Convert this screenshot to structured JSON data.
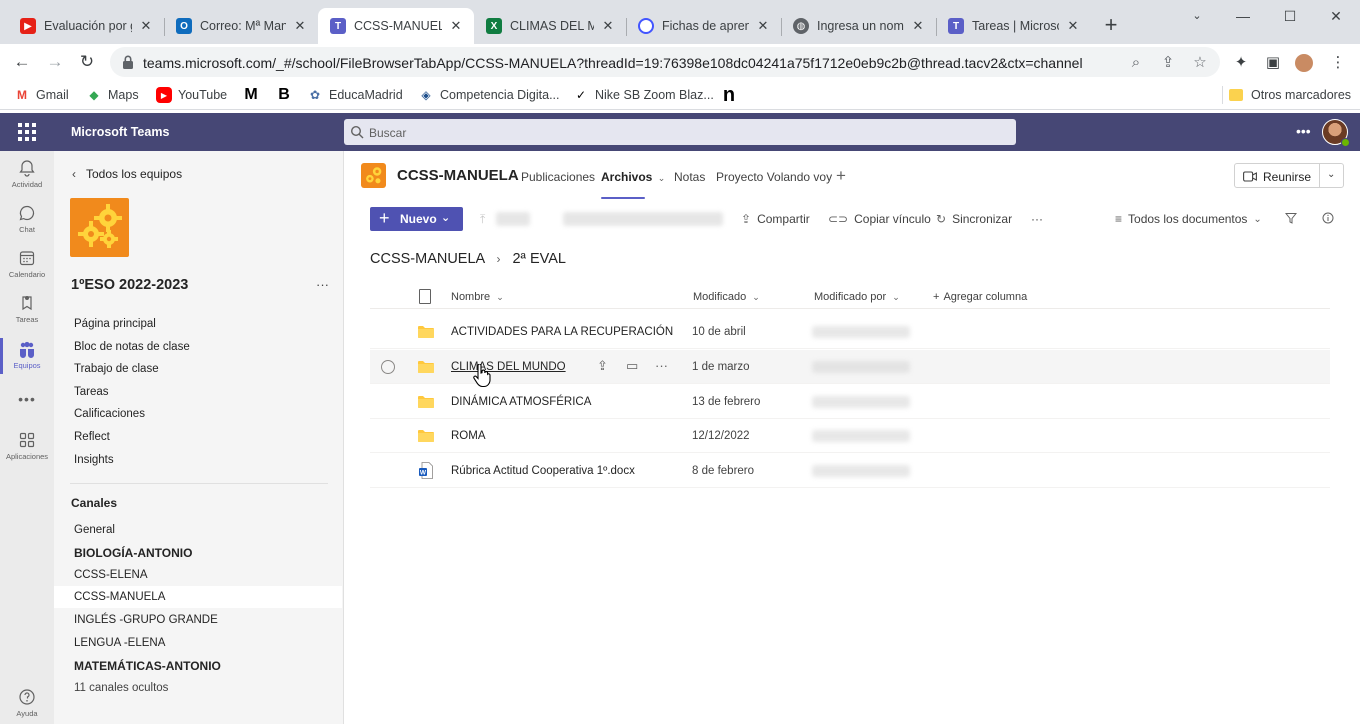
{
  "browser": {
    "tabs": [
      {
        "title": "Evaluación por gru",
        "icon": "youtube-favicon",
        "color": "#ff0000",
        "active": false
      },
      {
        "title": "Correo: Mª Manue",
        "icon": "outlook-favicon",
        "color": "#0f6cbd",
        "active": false
      },
      {
        "title": "CCSS-MANUELA",
        "icon": "teams-favicon",
        "color": "#5b5fc7",
        "active": true
      },
      {
        "title": "CLIMAS DEL MUND",
        "icon": "excel-favicon",
        "color": "#107c41",
        "active": false
      },
      {
        "title": "Fichas de aprendiz",
        "icon": "quizlet-favicon",
        "color": "#4255ff",
        "active": false
      },
      {
        "title": "Ingresa un nombre",
        "icon": "globe-favicon",
        "color": "#5f6368",
        "active": false
      },
      {
        "title": "Tareas | Microsoft",
        "icon": "teams-favicon",
        "color": "#5b5fc7",
        "active": false
      }
    ],
    "url": "teams.microsoft.com/_#/school/FileBrowserTabApp/CCSS-MANUELA?threadId=19:76398e108dc04241a75f1712e0eb9c2b@thread.tacv2&ctx=channel",
    "bookmarks": [
      {
        "label": "Gmail",
        "icon": "gmail-icon"
      },
      {
        "label": "Maps",
        "icon": "maps-icon"
      },
      {
        "label": "YouTube",
        "icon": "youtube-icon"
      },
      {
        "label": "",
        "icon": "medium-icon"
      },
      {
        "label": "",
        "icon": "bold-b-icon"
      },
      {
        "label": "EducaMadrid",
        "icon": "educamadrid-icon"
      },
      {
        "label": "Competencia Digita...",
        "icon": "graduation-cap-icon"
      },
      {
        "label": "Nike SB Zoom Blaz...",
        "icon": "nike-icon"
      },
      {
        "label": "",
        "icon": "n-logo-icon"
      }
    ],
    "other_bookmarks": "Otros marcadores"
  },
  "teams": {
    "app_title": "Microsoft Teams",
    "search_placeholder": "Buscar",
    "rail": [
      {
        "label": "Actividad",
        "icon": "bell-icon"
      },
      {
        "label": "Chat",
        "icon": "chat-icon"
      },
      {
        "label": "Calendario",
        "icon": "calendar-icon"
      },
      {
        "label": "Tareas",
        "icon": "assignments-icon"
      },
      {
        "label": "Equipos",
        "icon": "teams-icon"
      },
      {
        "label": "Aplicaciones",
        "icon": "apps-icon"
      },
      {
        "label": "Ayuda",
        "icon": "help-icon"
      }
    ],
    "sidebar": {
      "back_label": "Todos los equipos",
      "team_name": "1ºESO 2022-2023",
      "nav": [
        "Página principal",
        "Bloc de notas de clase",
        "Trabajo de clase",
        "Tareas",
        "Calificaciones",
        "Reflect",
        "Insights"
      ],
      "channels_heading": "Canales",
      "channels": [
        {
          "name": "General",
          "bold": false
        },
        {
          "name": "BIOLOGÍA-ANTONIO",
          "bold": true
        },
        {
          "name": "CCSS-ELENA",
          "bold": false
        },
        {
          "name": "CCSS-MANUELA",
          "bold": false,
          "selected": true
        },
        {
          "name": "INGLÉS -GRUPO GRANDE",
          "bold": false
        },
        {
          "name": "LENGUA -ELENA",
          "bold": false
        },
        {
          "name": "MATEMÁTICAS-ANTONIO",
          "bold": true
        }
      ],
      "hidden_channels": "11 canales ocultos"
    },
    "channel": {
      "name": "CCSS-MANUELA",
      "tabs": [
        "Publicaciones",
        "Archivos",
        "Notas",
        "Proyecto Volando voy"
      ],
      "meet_label": "Reunirse"
    },
    "toolbar": {
      "new_label": "Nuevo",
      "share": "Compartir",
      "copy_link": "Copiar vínculo",
      "sync": "Sincronizar",
      "view": "Todos los documentos"
    },
    "breadcrumb": [
      "CCSS-MANUELA",
      "2ª EVAL"
    ],
    "columns": {
      "name": "Nombre",
      "modified": "Modificado",
      "modified_by": "Modificado por",
      "add": "Agregar columna"
    },
    "files": [
      {
        "name": "ACTIVIDADES PARA LA RECUPERACIÓN",
        "modified": "10 de abril",
        "type": "folder"
      },
      {
        "name": "CLIMAS DEL MUNDO",
        "modified": "1 de marzo",
        "type": "folder",
        "hover": true
      },
      {
        "name": "DINÁMICA ATMOSFÉRICA",
        "modified": "13 de febrero",
        "type": "folder"
      },
      {
        "name": "ROMA",
        "modified": "12/12/2022",
        "type": "folder"
      },
      {
        "name": "Rúbrica Actitud Cooperativa 1º.docx",
        "modified": "8 de febrero",
        "type": "docx"
      }
    ]
  }
}
